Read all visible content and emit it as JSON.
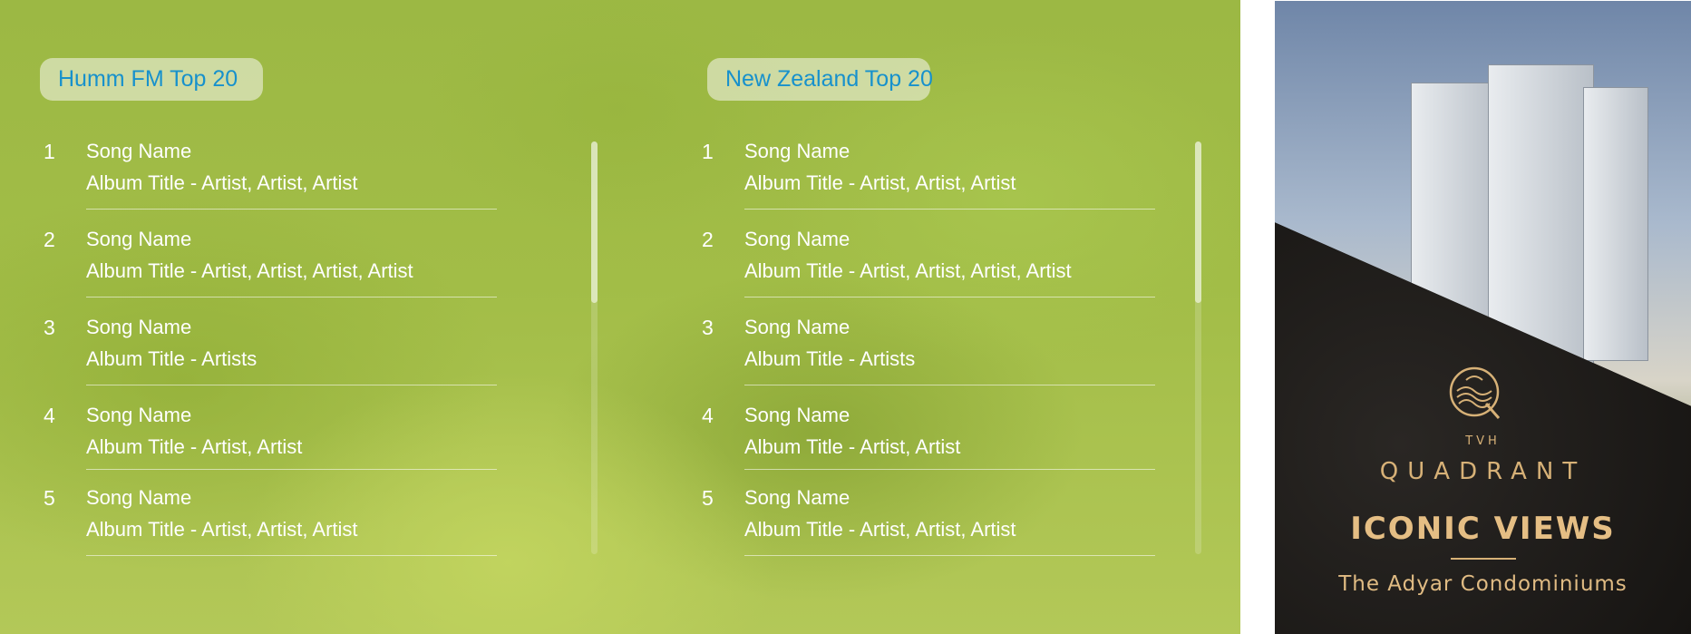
{
  "charts": [
    {
      "title": "Humm FM Top 20",
      "items": [
        {
          "rank": "1",
          "song": "Song Name",
          "album": "Album Title - Artist, Artist, Artist"
        },
        {
          "rank": "2",
          "song": "Song Name",
          "album": "Album Title - Artist, Artist, Artist, Artist"
        },
        {
          "rank": "3",
          "song": "Song Name",
          "album": "Album Title - Artists"
        },
        {
          "rank": "4",
          "song": "Song Name",
          "album": "Album Title - Artist, Artist"
        },
        {
          "rank": "5",
          "song": "Song Name",
          "album": "Album Title - Artist, Artist, Artist"
        }
      ]
    },
    {
      "title": "New Zealand Top 20",
      "items": [
        {
          "rank": "1",
          "song": "Song Name",
          "album": "Album Title - Artist, Artist, Artist"
        },
        {
          "rank": "2",
          "song": "Song Name",
          "album": "Album Title - Artist, Artist, Artist, Artist"
        },
        {
          "rank": "3",
          "song": "Song Name",
          "album": "Album Title - Artists"
        },
        {
          "rank": "4",
          "song": "Song Name",
          "album": "Album Title - Artist, Artist"
        },
        {
          "rank": "5",
          "song": "Song Name",
          "album": "Album Title - Artist, Artist, Artist"
        }
      ]
    }
  ],
  "ad": {
    "brand_small": "TVH",
    "brand": "QUADRANT",
    "headline": "ICONIC VIEWS",
    "subline": "The  Adyar Condominiums",
    "accent_color": "#d7b177"
  },
  "colors": {
    "title_text": "#1791cc",
    "list_text": "#ffffff"
  }
}
